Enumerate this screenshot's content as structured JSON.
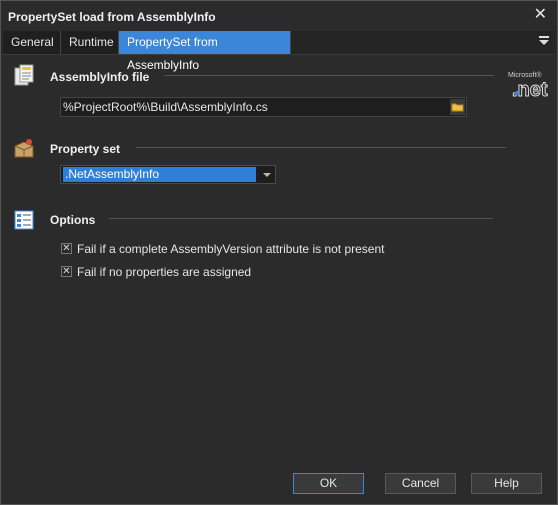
{
  "window": {
    "title": "PropertySet load from AssemblyInfo",
    "close_glyph": "✕"
  },
  "tabs": [
    {
      "label": "General",
      "active": false
    },
    {
      "label": "Runtime",
      "active": false
    },
    {
      "label": "PropertySet from AssemblyInfo",
      "active": true
    }
  ],
  "assembly_info": {
    "label": "AssemblyInfo file",
    "path_value": "%ProjectRoot%\\Build\\AssemblyInfo.cs",
    "icon": "document-icon",
    "browse_icon": "folder-icon"
  },
  "property_set": {
    "label": "Property set",
    "selected": ".NetAssemblyInfo",
    "icon": "package-icon"
  },
  "options": {
    "label": "Options",
    "icon": "options-list-icon",
    "items": [
      {
        "label": "Fail if a complete AssemblyVersion attribute is not present",
        "checked": true
      },
      {
        "label": "Fail if no properties are assigned",
        "checked": true
      }
    ]
  },
  "buttons": {
    "ok": "OK",
    "cancel": "Cancel",
    "help": "Help"
  },
  "colors": {
    "accent": "#3b86d9",
    "background": "#2b2b2b"
  }
}
